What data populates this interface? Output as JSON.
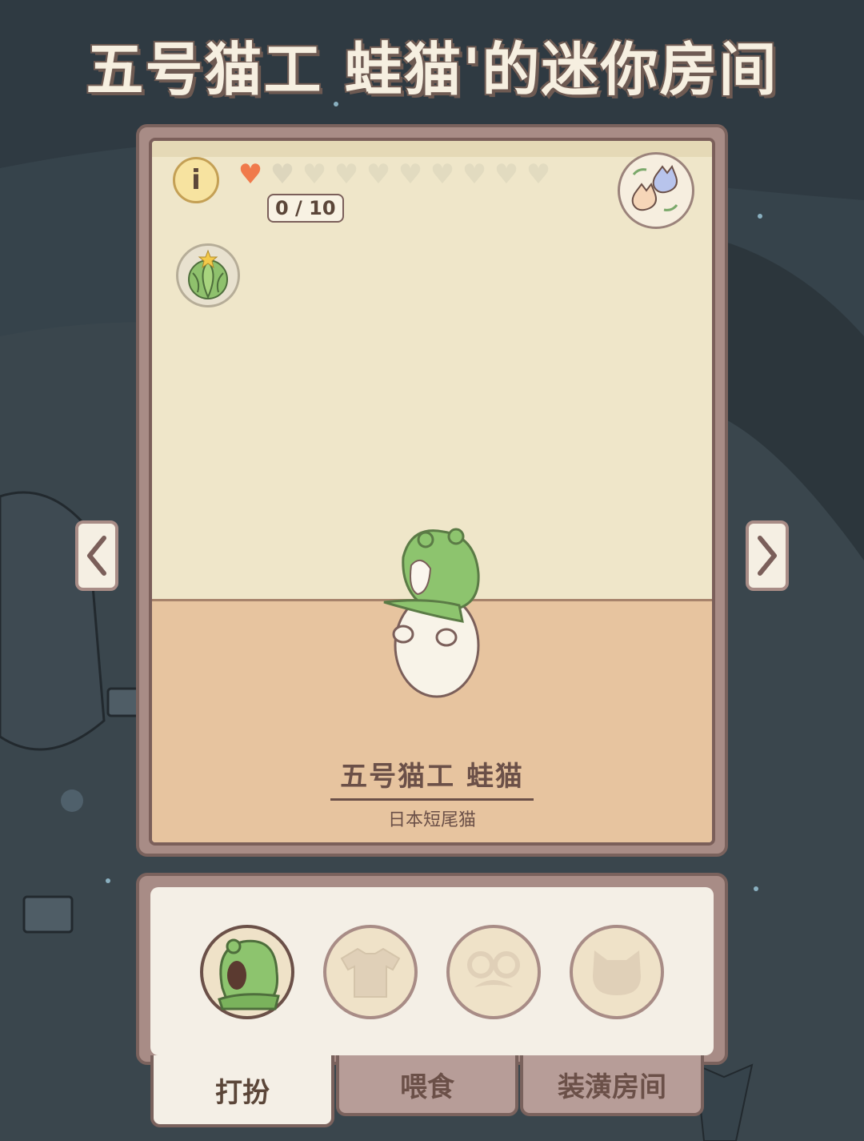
{
  "title": "五号猫工 蛙猫'的迷你房间",
  "room": {
    "affection": {
      "filled_hearts": 1,
      "total_hearts": 10,
      "count_text": "0 / 10"
    },
    "info_icon": "i",
    "cat": {
      "name": "五号猫工 蛙猫",
      "breed": "日本短尾猫"
    }
  },
  "tabs": [
    {
      "label": "打扮",
      "active": true
    },
    {
      "label": "喂食",
      "active": false
    },
    {
      "label": "装潢房间",
      "active": false
    }
  ],
  "dress_options": [
    "frog-hat-icon",
    "shirt-icon",
    "glasses-mustache-icon",
    "cat-face-icon"
  ],
  "colors": {
    "heart_filled": "#f07a4b",
    "heart_empty": "#e2dbc0",
    "panel_border": "#a88c86",
    "text_brown": "#6b5048"
  }
}
